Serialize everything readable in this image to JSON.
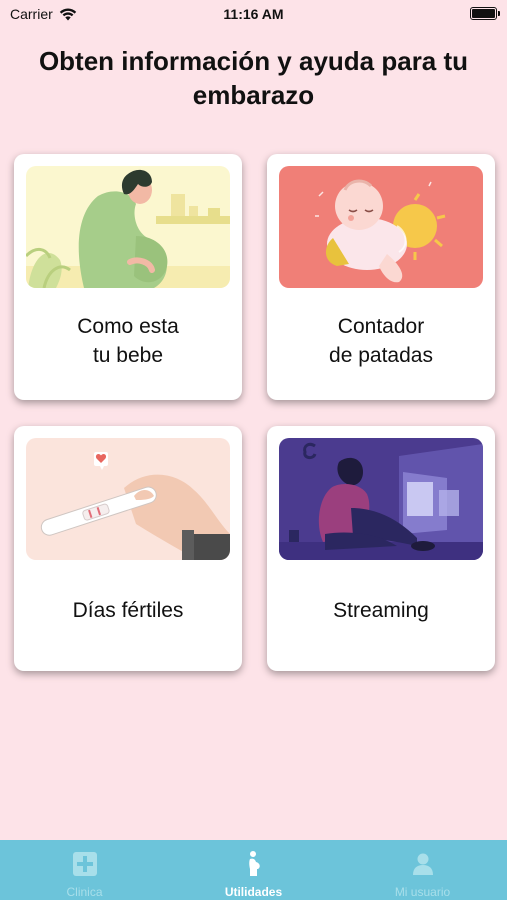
{
  "status_bar": {
    "carrier": "Carrier",
    "time": "11:16 AM"
  },
  "title": "Obten información y ayuda para tu embarazo",
  "cards": [
    {
      "label": "Como esta\ntu bebe",
      "icon": "pregnant-woman-illustration"
    },
    {
      "label": "Contador\nde patadas",
      "icon": "baby-kicks-illustration"
    },
    {
      "label": "Días fértiles",
      "icon": "pregnancy-test-illustration"
    },
    {
      "label": "Streaming",
      "icon": "streaming-illustration"
    }
  ],
  "tabs": [
    {
      "label": "Clinica",
      "icon": "medical-cross-icon",
      "active": false
    },
    {
      "label": "Utilidades",
      "icon": "pregnant-figure-icon",
      "active": true
    },
    {
      "label": "Mi usuario",
      "icon": "user-icon",
      "active": false
    }
  ],
  "colors": {
    "background": "#fde3e8",
    "tab_bar": "#6cc4da",
    "tab_active": "#ffffff",
    "tab_inactive": "#a8dfea"
  }
}
